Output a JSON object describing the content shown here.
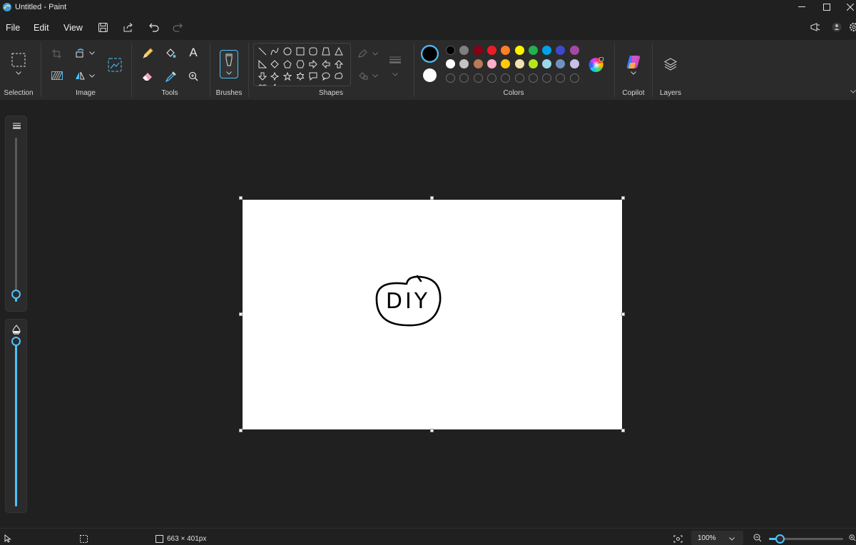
{
  "window": {
    "title": "Untitled - Paint"
  },
  "menu": {
    "file": "File",
    "edit": "Edit",
    "view": "View"
  },
  "ribbon": {
    "groups": {
      "selection": "Selection",
      "image": "Image",
      "tools": "Tools",
      "brushes": "Brushes",
      "shapes": "Shapes",
      "colors": "Colors",
      "copilot": "Copilot",
      "layers": "Layers"
    },
    "tools_text_glyph": "A"
  },
  "colors": {
    "primary": "#000000",
    "secondary": "#ffffff",
    "row1": [
      "#000000",
      "#7f7f7f",
      "#880015",
      "#ed1c24",
      "#ff7f27",
      "#fff200",
      "#22b14c",
      "#00a2e8",
      "#3f48cc",
      "#a349a4"
    ],
    "row2": [
      "#ffffff",
      "#c3c3c3",
      "#b97a57",
      "#ffaec9",
      "#ffc90e",
      "#efe4b0",
      "#b5e61d",
      "#99d9ea",
      "#7092be",
      "#c8bfe7"
    ],
    "custom_slots": 10,
    "accent": "#4cc2ff"
  },
  "canvas": {
    "drawing_text": "DIY"
  },
  "sliders": {
    "size_level": 0.05,
    "opacity_level": 1.0
  },
  "status": {
    "canvas_size": "663 × 401px",
    "zoom": "100%"
  },
  "icons": {
    "app": "paint-app-icon",
    "save": "save-icon",
    "share": "share-icon",
    "undo": "undo-icon",
    "redo": "redo-icon"
  }
}
